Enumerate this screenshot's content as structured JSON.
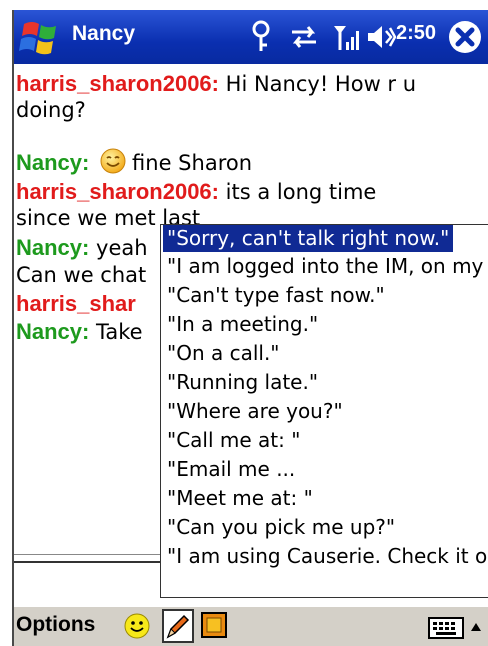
{
  "window": {
    "title": "Nancy",
    "clock": "2:50"
  },
  "chat": {
    "messages": [
      {
        "nick": "harris_sharon2006:",
        "text_line1": " Hi Nancy! How r u",
        "text_line2": "doing?"
      },
      {
        "nick": "Nancy:",
        "text_line1": "fine Sharon"
      },
      {
        "nick": "harris_sharon2006:",
        "text_line1": " its a long time",
        "text_line2": "since we met last"
      },
      {
        "nick": "Nancy:",
        "text_line1": " yeah",
        "text_line2": "Can we chat"
      },
      {
        "nick": "harris_shar"
      },
      {
        "nick": "Nancy:",
        "text_line1": " Take"
      }
    ]
  },
  "quick_replies": {
    "items": [
      "\"Sorry, can't talk right now.\"",
      "\"I am logged into the IM, on my m",
      "\"Can't type fast now.\"",
      "\"In a meeting.\"",
      "\"On a call.\"",
      "\"Running late.\"",
      "\"Where are you?\"",
      "\"Call me at: \"",
      "\"Email me ...",
      "\"Meet me at: \"",
      "\"Can you pick me up?\"",
      "\"I am using Causerie. Check it out"
    ],
    "selected_index": 0
  },
  "bottombar": {
    "options_label": "Options"
  },
  "colors": {
    "titlebar": "#0a2fb0",
    "nick_other": "#e11b1b",
    "nick_self": "#1d9a1d",
    "selection": "#102a94"
  }
}
